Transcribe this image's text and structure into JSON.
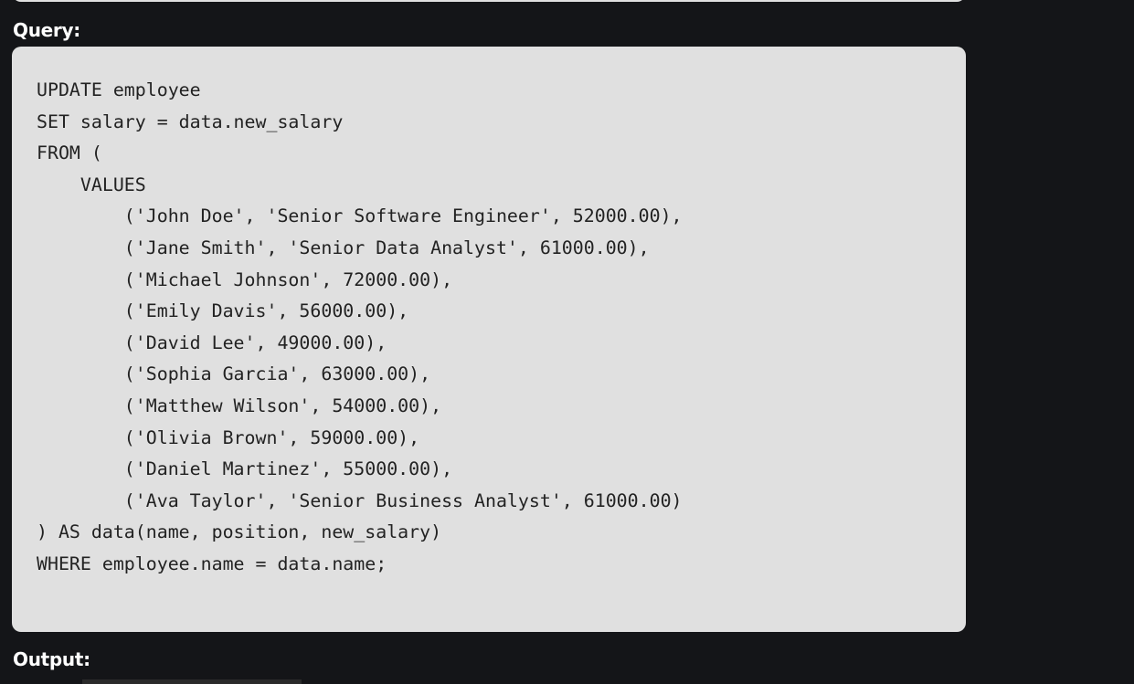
{
  "query_label": "Query:",
  "query_code": "UPDATE employee\nSET salary = data.new_salary\nFROM (\n    VALUES\n        ('John Doe', 'Senior Software Engineer', 52000.00),\n        ('Jane Smith', 'Senior Data Analyst', 61000.00),\n        ('Michael Johnson', 72000.00),\n        ('Emily Davis', 56000.00),\n        ('David Lee', 49000.00),\n        ('Sophia Garcia', 63000.00),\n        ('Matthew Wilson', 54000.00),\n        ('Olivia Brown', 59000.00),\n        ('Daniel Martinez', 55000.00),\n        ('Ava Taylor', 'Senior Business Analyst', 61000.00)\n) AS data(name, position, new_salary)\nWHERE employee.name = data.name;",
  "output_label": "Output:",
  "colors": {
    "background": "#141518",
    "code_background": "#e0e0e0",
    "code_text": "#222222",
    "label_text": "#ffffff"
  }
}
